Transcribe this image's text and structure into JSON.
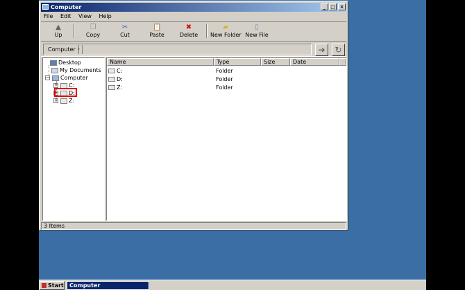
{
  "window": {
    "title": "Computer"
  },
  "title_buttons": {
    "minimize": "_",
    "maximize": "□",
    "close": "×"
  },
  "menu": [
    "File",
    "Edit",
    "View",
    "Help"
  ],
  "toolbar": {
    "up": "Up",
    "copy": "Copy",
    "cut": "Cut",
    "paste": "Paste",
    "delete": "Delete",
    "new_folder": "New Folder",
    "new_file": "New File"
  },
  "address": {
    "crumb": "Computer",
    "crumb_arrow": "›"
  },
  "tree": {
    "desktop": "Desktop",
    "my_documents": "My Documents",
    "computer": "Computer",
    "drives": [
      "C:",
      "D:",
      "Z:"
    ]
  },
  "list": {
    "columns": [
      "Name",
      "Type",
      "Size",
      "Date"
    ],
    "rows": [
      {
        "name": "C:",
        "type": "Folder",
        "size": "",
        "date": ""
      },
      {
        "name": "D:",
        "type": "Folder",
        "size": "",
        "date": ""
      },
      {
        "name": "Z:",
        "type": "Folder",
        "size": "",
        "date": ""
      }
    ]
  },
  "status": {
    "text": "3 Items"
  },
  "taskbar": {
    "start": "Start",
    "task": "Computer"
  },
  "icons": {
    "up": "up-arrow-icon",
    "copy": "copy-icon",
    "cut": "scissors-icon",
    "paste": "paste-icon",
    "delete": "red-x-icon",
    "new_folder": "folder-icon",
    "new_file": "new-file-icon",
    "go": "right-arrow-icon",
    "refresh": "refresh-icon"
  },
  "colors": {
    "desktop": "#3a6ea5",
    "titlebar": "#0a246a",
    "highlight": "#e00000",
    "delete_red": "#d01010"
  }
}
